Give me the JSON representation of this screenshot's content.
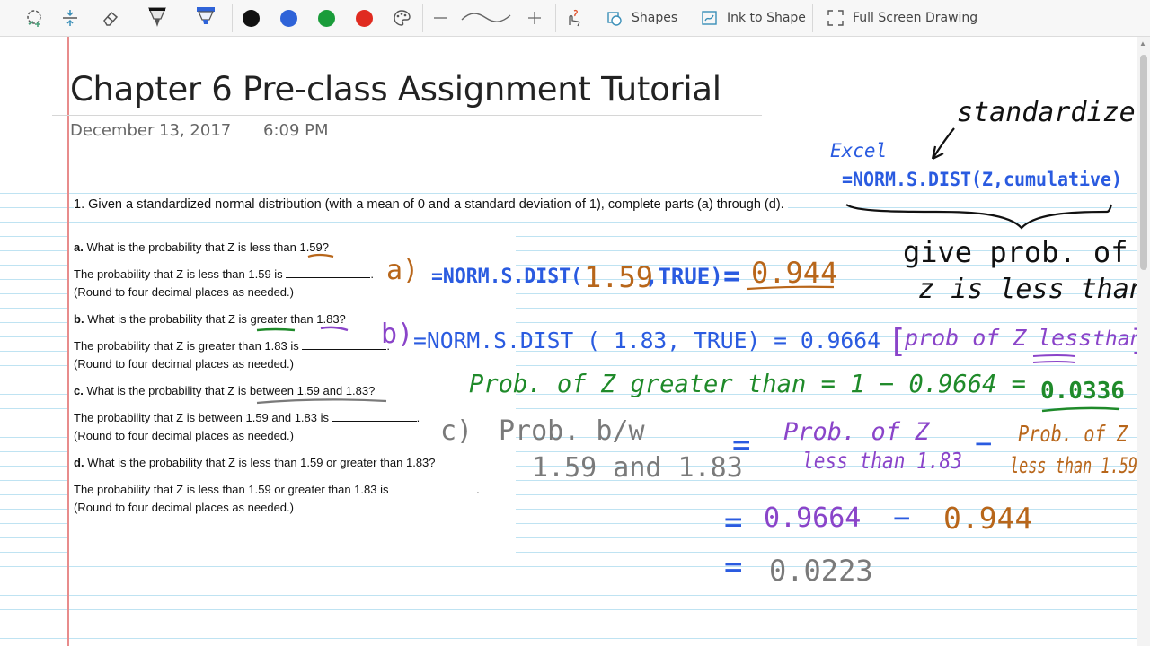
{
  "toolbar": {
    "tools": [
      "lasso-select-icon",
      "insert-space-icon",
      "eraser-icon",
      "pen-icon",
      "highlighter-icon"
    ],
    "colors": [
      {
        "name": "black",
        "hex": "#111111"
      },
      {
        "name": "blue",
        "hex": "#2f63d8"
      },
      {
        "name": "green",
        "hex": "#1a9c3a"
      },
      {
        "name": "red",
        "hex": "#e02b20"
      }
    ],
    "shapes_label": "Shapes",
    "ink_to_shape_label": "Ink to Shape",
    "full_screen_label": "Full Screen Drawing"
  },
  "page": {
    "title": "Chapter 6 Pre-class Assignment Tutorial",
    "date": "December 13, 2017",
    "time": "6:09 PM"
  },
  "question": {
    "main": "1.   Given a standardized normal distribution (with a mean of 0 and a standard deviation of 1), complete parts (a) through (d).",
    "a_label": "a.",
    "a_prompt": "What is the probability that Z is less than 1.59?",
    "a_answer_pre": "The probability that Z is less than 1.59 is",
    "a_round": "(Round to four decimal places as needed.)",
    "b_label": "b.",
    "b_prompt": "What is the probability that Z is greater than 1.83?",
    "b_answer_pre": "The probability that Z is greater than 1.83 is",
    "b_round": "(Round to four decimal places as needed.)",
    "c_label": "c.",
    "c_prompt": "What is the probability that Z is between 1.59 and 1.83?",
    "c_answer_pre": "The probability that Z is between 1.59 and 1.83 is",
    "c_round": "(Round to four decimal places as needed.)",
    "d_label": "d.",
    "d_prompt": "What is the probability that Z is less than 1.59 or greater than 1.83?",
    "d_answer_pre": "The probability that Z is less than 1.59 or greater than 1.83 is",
    "d_round": "(Round to four decimal places as needed.)"
  },
  "ink": {
    "standardized": "standardized",
    "excel": "Excel",
    "normsdist_syntax": "=NORM.S.DIST(Z,cumulative)",
    "give_prob_of": "give prob. of",
    "z_is_less_than": "z is less than",
    "a_label": "a)",
    "a_formula": "=NORM.S.DIST(",
    "a_arg": "1.59",
    "a_true": ",TRUE)",
    "a_eq": "=",
    "a_result": "0.944",
    "b_label": "b)",
    "b_formula": "=NORM.S.DIST ( 1.83, TRUE) = 0.9664",
    "b_note_open": "[",
    "b_note_prob": "prob of Z",
    "b_note_less": "less",
    "b_note_than": "than",
    "b_note_close": "]",
    "b_line2": "Prob. of Z greater than = 1 − 0.9664 =",
    "b_result": "0.0336",
    "c_label": "c)",
    "c_desc1": "Prob. b/w",
    "c_desc2": "1.59 and 1.83",
    "c_eq": "=",
    "c_term1_l1": "Prob. of Z",
    "c_term1_l2": "less than 1.83",
    "c_minus": "−",
    "c_term2_l1": "Prob. of Z",
    "c_term2_l2": "less than 1.59",
    "c_eq2": "=",
    "c_val1": "0.9664",
    "c_minus2": "−",
    "c_val2": "0.944",
    "c_eq3": "=",
    "c_result": "0.0223"
  },
  "colors": {
    "ink_blue": "#2a5be0",
    "ink_brown": "#b8661a",
    "ink_purple": "#8a44c9",
    "ink_green": "#1f8a2a",
    "ink_gray": "#7a7a7a",
    "ink_black": "#111111",
    "margin_red": "#e88c8c",
    "rule_blue": "#bfe3f2"
  }
}
